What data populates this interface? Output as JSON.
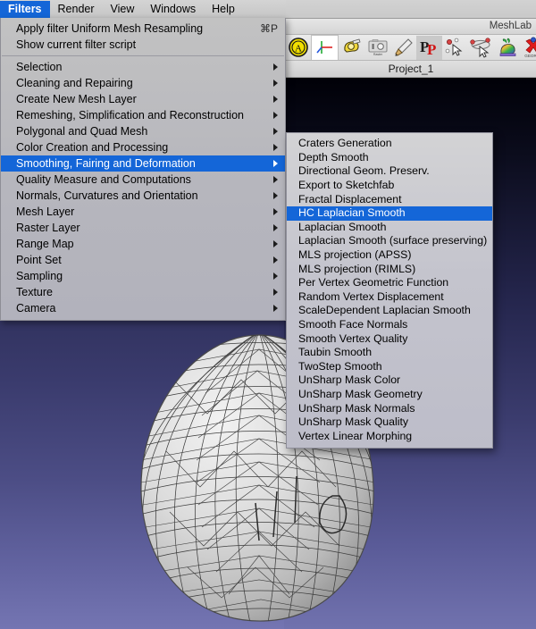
{
  "window": {
    "app_title": "MeshLab",
    "project_tab": "Project_1"
  },
  "menubar": {
    "items": [
      {
        "label": "Filters",
        "active": true
      },
      {
        "label": "Render",
        "active": false
      },
      {
        "label": "View",
        "active": false
      },
      {
        "label": "Windows",
        "active": false
      },
      {
        "label": "Help",
        "active": false
      }
    ]
  },
  "filters_menu": {
    "top_items": [
      {
        "label": "Apply filter Uniform Mesh Resampling",
        "shortcut": "⌘P",
        "submenu": false
      },
      {
        "label": "Show current filter script",
        "shortcut": "",
        "submenu": false
      }
    ],
    "categories": [
      {
        "label": "Selection",
        "submenu": true,
        "highlight": false
      },
      {
        "label": "Cleaning and Repairing",
        "submenu": true,
        "highlight": false
      },
      {
        "label": "Create New Mesh Layer",
        "submenu": true,
        "highlight": false
      },
      {
        "label": "Remeshing, Simplification and Reconstruction",
        "submenu": true,
        "highlight": false
      },
      {
        "label": "Polygonal and Quad Mesh",
        "submenu": true,
        "highlight": false
      },
      {
        "label": "Color Creation and Processing",
        "submenu": true,
        "highlight": false
      },
      {
        "label": "Smoothing, Fairing and Deformation",
        "submenu": true,
        "highlight": true
      },
      {
        "label": "Quality Measure and Computations",
        "submenu": true,
        "highlight": false
      },
      {
        "label": "Normals, Curvatures and Orientation",
        "submenu": true,
        "highlight": false
      },
      {
        "label": "Mesh Layer",
        "submenu": true,
        "highlight": false
      },
      {
        "label": "Raster Layer",
        "submenu": true,
        "highlight": false
      },
      {
        "label": "Range Map",
        "submenu": true,
        "highlight": false
      },
      {
        "label": "Point Set",
        "submenu": true,
        "highlight": false
      },
      {
        "label": "Sampling",
        "submenu": true,
        "highlight": false
      },
      {
        "label": "Texture",
        "submenu": true,
        "highlight": false
      },
      {
        "label": "Camera",
        "submenu": true,
        "highlight": false
      }
    ]
  },
  "smoothing_submenu": {
    "items": [
      {
        "label": "Craters Generation",
        "highlight": false
      },
      {
        "label": "Depth Smooth",
        "highlight": false
      },
      {
        "label": "Directional Geom. Preserv.",
        "highlight": false
      },
      {
        "label": "Export to Sketchfab",
        "highlight": false
      },
      {
        "label": "Fractal Displacement",
        "highlight": false
      },
      {
        "label": "HC Laplacian Smooth",
        "highlight": true
      },
      {
        "label": "Laplacian Smooth",
        "highlight": false
      },
      {
        "label": "Laplacian Smooth (surface preserving)",
        "highlight": false
      },
      {
        "label": "MLS projection (APSS)",
        "highlight": false
      },
      {
        "label": "MLS projection (RIMLS)",
        "highlight": false
      },
      {
        "label": "Per Vertex Geometric Function",
        "highlight": false
      },
      {
        "label": "Random Vertex Displacement",
        "highlight": false
      },
      {
        "label": "ScaleDependent Laplacian Smooth",
        "highlight": false
      },
      {
        "label": "Smooth Face Normals",
        "highlight": false
      },
      {
        "label": "Smooth Vertex Quality",
        "highlight": false
      },
      {
        "label": "Taubin Smooth",
        "highlight": false
      },
      {
        "label": "TwoStep Smooth",
        "highlight": false
      },
      {
        "label": "UnSharp Mask Color",
        "highlight": false
      },
      {
        "label": "UnSharp Mask Geometry",
        "highlight": false
      },
      {
        "label": "UnSharp Mask Normals",
        "highlight": false
      },
      {
        "label": "UnSharp Mask Quality",
        "highlight": false
      },
      {
        "label": "Vertex Linear Morphing",
        "highlight": false
      }
    ]
  },
  "toolbar": {
    "buttons": [
      {
        "icon": "align-mesh-letter-a-icon",
        "title": "A"
      },
      {
        "icon": "axis-gizmo-icon",
        "title": ""
      },
      {
        "icon": "measuring-tape-icon",
        "title": ""
      },
      {
        "icon": "raster-alignment-camera-icon",
        "title": "Raster Alignment"
      },
      {
        "icon": "paintbrush-icon",
        "title": ""
      },
      {
        "icon": "pp-picked-points-icon",
        "title": "PP"
      },
      {
        "icon": "point-picker-icon",
        "title": ""
      },
      {
        "icon": "edit-references-icon",
        "title": ""
      },
      {
        "icon": "rainbow-bunny-icon",
        "title": ""
      },
      {
        "icon": "georef-red-x-icon",
        "title": "GEOREF"
      }
    ]
  },
  "viewport": {
    "background_top": "#000007",
    "background_bottom": "#7475b2",
    "model_name": "egg-mesh-wireframe"
  }
}
